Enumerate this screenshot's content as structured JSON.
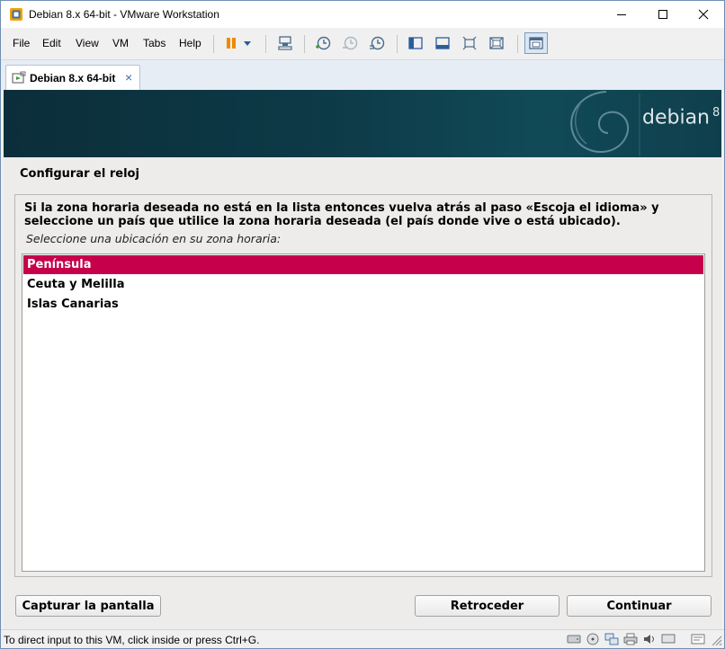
{
  "window": {
    "title": "Debian 8.x 64-bit - VMware Workstation"
  },
  "menu": {
    "items": [
      "File",
      "Edit",
      "View",
      "VM",
      "Tabs",
      "Help"
    ]
  },
  "toolbar": {
    "icons": [
      "pause-icon",
      "dropdown-arrow-icon",
      "send-ctrl-alt-del-icon",
      "take-snapshot-icon",
      "revert-snapshot-icon",
      "snapshot-manager-icon",
      "show-library-icon",
      "thumbnail-bar-icon",
      "full-screen-icon",
      "unity-icon",
      "console-view-icon"
    ]
  },
  "tab": {
    "label": "Debian 8.x 64-bit",
    "close": "×"
  },
  "installer": {
    "logo_text": "debian",
    "logo_version": "8",
    "step_title": "Configurar el reloj",
    "help_text": "Si la zona horaria deseada no está en la lista entonces vuelva atrás al paso «Escoja el idioma» y seleccione un país que utilice la zona horaria deseada (el país donde vive o está ubicado).",
    "prompt": "Seleccione una ubicación en su zona horaria:",
    "options": [
      "Península",
      "Ceuta y Melilla",
      "Islas Canarias"
    ],
    "selected_index": 0,
    "buttons": {
      "screenshot": "Capturar la pantalla",
      "back": "Retroceder",
      "continue": "Continuar"
    },
    "colors": {
      "selection": "#c7004c",
      "banner": "#0d3a47"
    }
  },
  "statusbar": {
    "text": "To direct input to this VM, click inside or press Ctrl+G.",
    "device_icons": [
      "hard-disk-icon",
      "cd-dvd-icon",
      "network-adapter-icon",
      "printer-icon",
      "sound-card-icon",
      "display-icon"
    ]
  }
}
